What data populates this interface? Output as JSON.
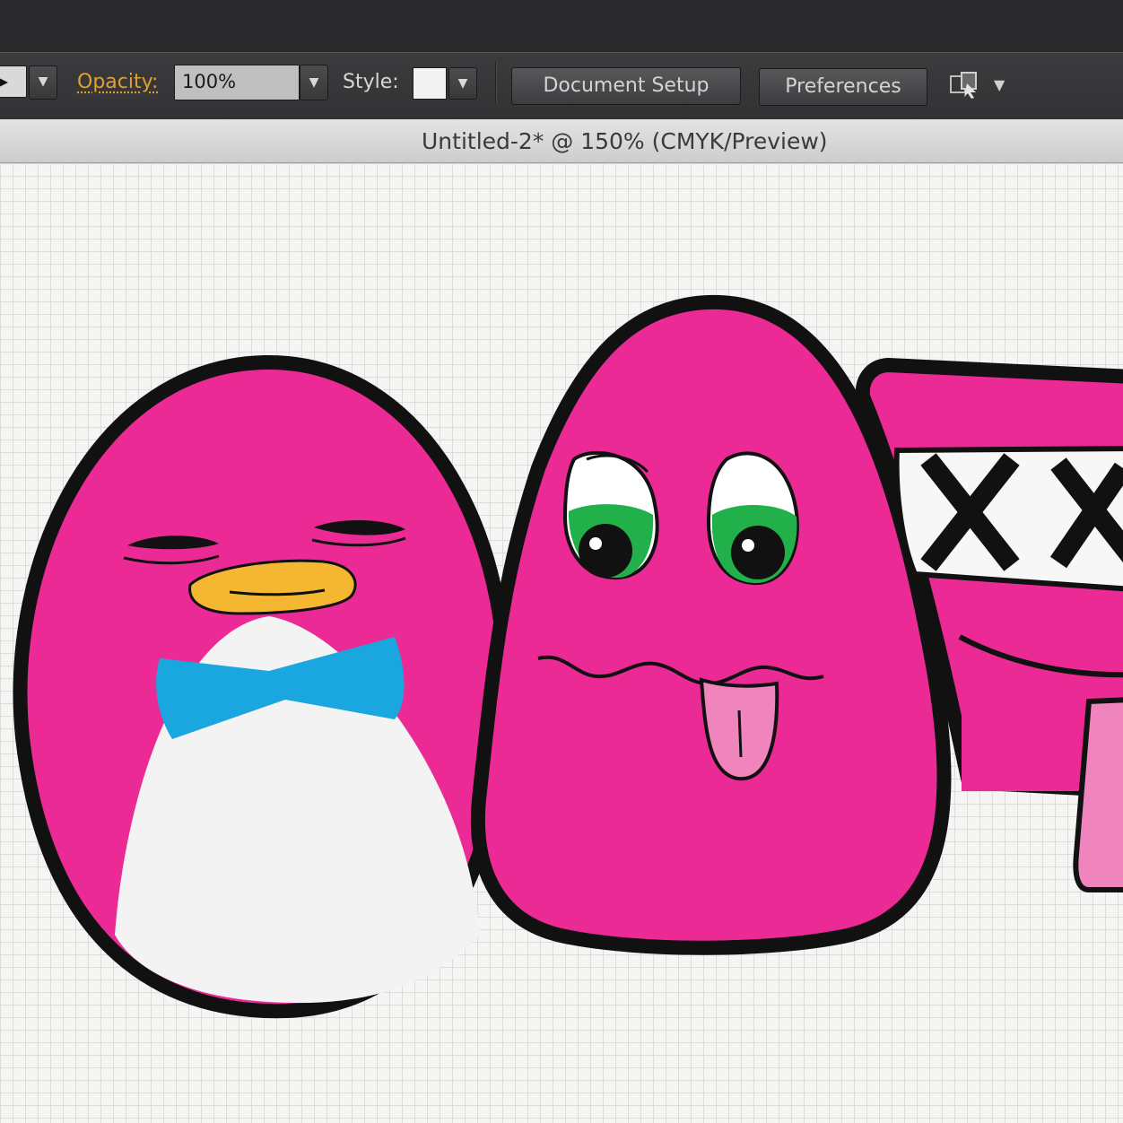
{
  "control_bar": {
    "opacity_label": "Opacity:",
    "opacity_value": "100%",
    "style_label": "Style:",
    "document_setup_label": "Document Setup",
    "preferences_label": "Preferences"
  },
  "document": {
    "title": "Untitled-2* @ 150% (CMYK/Preview)"
  },
  "icons": [
    "chevron-down-icon",
    "arrange-documents-icon"
  ],
  "colors": {
    "artwork_pink": "#ec2a96",
    "outline": "#111111",
    "beak": "#f5b731",
    "bowtie": "#1aa6de",
    "iris": "#22b04a",
    "tongue": "#f084bd",
    "opacity_label": "#e0a030"
  }
}
